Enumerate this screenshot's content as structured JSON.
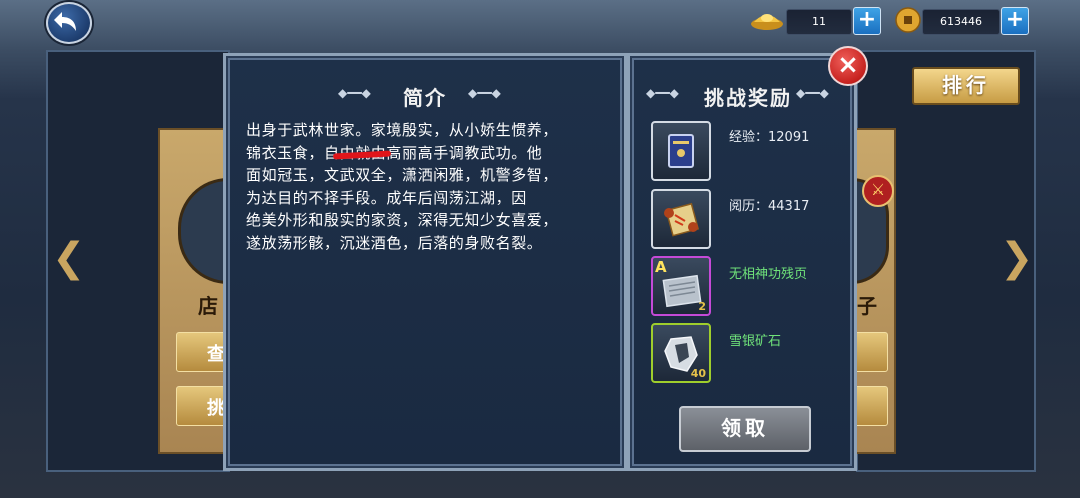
{
  "topbar": {
    "gold_ingot": "11",
    "coins": "613446",
    "plus_label": "+"
  },
  "left_card": {
    "name_fragment": "店",
    "btn1": "查",
    "btn2": "挑"
  },
  "right_card": {
    "name_fragment": "子"
  },
  "nav": {
    "prev": "❮",
    "next": "❯"
  },
  "intro_panel": {
    "title": "简介",
    "lines": [
      "出身于武林世家。家境殷实，从小娇生惯养，",
      "锦衣玉食，自由就由高丽高手调教武功。他",
      "面如冠玉，文武双全，潇洒闲雅，机警多智，",
      "为达目的不择手段。成年后闯荡江湖，因",
      "绝美外形和殷实的家资，深得无知少女喜爱，",
      "遂放荡形骸，沉迷酒色，后落的身败名裂。"
    ]
  },
  "reward_panel": {
    "title": "挑战奖励",
    "items": [
      {
        "text": "经验：12091",
        "icon": "book-icon",
        "grade": "",
        "qty": ""
      },
      {
        "text": "阅历：44317",
        "icon": "scroll-icon",
        "grade": "",
        "qty": ""
      },
      {
        "text": "无相神功残页",
        "icon": "manual-page-icon",
        "grade": "A",
        "qty": "2"
      },
      {
        "text": "雪银矿石",
        "icon": "ore-icon",
        "grade": "",
        "qty": "40"
      }
    ],
    "claim_label": "领取",
    "close_label": "×"
  },
  "rank_label": "排行",
  "colors": {
    "reward_name_green": "#6fe27a",
    "slot_purple": "#c54ad8",
    "slot_green": "#9fce2c",
    "close_red": "#c7221f"
  }
}
